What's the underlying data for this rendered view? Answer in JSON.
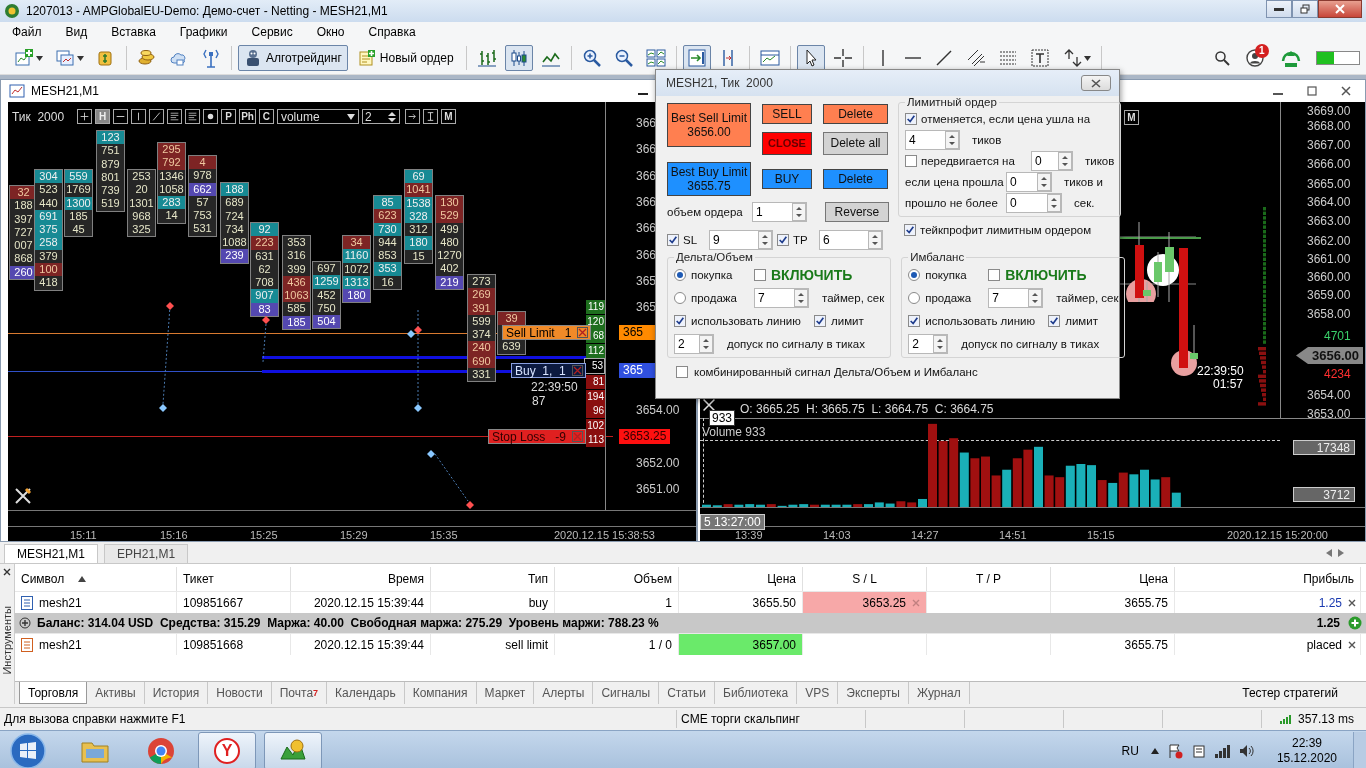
{
  "window": {
    "title": "1207013 - AMPGlobalEU-Demo: Демо-счет - Netting - MESH21,M1"
  },
  "menu": [
    "Файл",
    "Вид",
    "Вставка",
    "Графики",
    "Сервис",
    "Окно",
    "Справка"
  ],
  "toolbar": {
    "tools_left": [
      [
        {
          "kind": "new-chart",
          "selected": false
        },
        {
          "kind": "profiles",
          "selected": false
        },
        {
          "kind": "bag",
          "selected": false
        }
      ],
      [
        {
          "kind": "coins",
          "selected": false
        },
        {
          "kind": "cloud",
          "selected": false
        },
        {
          "kind": "signal",
          "selected": false
        }
      ]
    ],
    "algo_button": {
      "label": "Алготрейдинг",
      "selected": true
    },
    "new_order_button": {
      "label": "Новый ордер"
    },
    "tools_right": [
      [
        {
          "kind": "bars",
          "selected": false
        },
        {
          "kind": "candles",
          "selected": true
        },
        {
          "kind": "line",
          "selected": false
        }
      ],
      [
        {
          "kind": "zoom-in",
          "selected": false
        },
        {
          "kind": "zoom-out",
          "selected": false
        },
        {
          "kind": "tile",
          "selected": false
        }
      ],
      [
        {
          "kind": "autoscroll",
          "selected": true
        },
        {
          "kind": "shift",
          "selected": false
        }
      ],
      [
        {
          "kind": "template",
          "selected": false
        }
      ],
      [
        {
          "kind": "cursor",
          "selected": true
        },
        {
          "kind": "crosshair",
          "selected": false
        }
      ],
      [
        {
          "kind": "vline",
          "selected": false
        },
        {
          "kind": "hline",
          "selected": false
        },
        {
          "kind": "trend",
          "selected": false
        },
        {
          "kind": "channel",
          "selected": false
        },
        {
          "kind": "fibo",
          "selected": false
        },
        {
          "kind": "text",
          "selected": false
        },
        {
          "kind": "arrows",
          "selected": false
        }
      ]
    ],
    "notifications": "1"
  },
  "left_chart": {
    "title": "MESH21,M1",
    "period": "Тик  2000",
    "tools": [
      {
        "kind": "plus",
        "selected": false
      },
      {
        "kind": "letter",
        "label": "H",
        "selected": true
      },
      {
        "kind": "hline",
        "selected": false
      },
      {
        "kind": "vline",
        "selected": false
      },
      {
        "kind": "slash",
        "selected": false
      },
      {
        "kind": "lines",
        "selected": false
      },
      {
        "kind": "lines",
        "selected": false
      },
      {
        "kind": "dot",
        "selected": false
      },
      {
        "kind": "letter",
        "label": "P",
        "selected": false
      },
      {
        "kind": "letter",
        "label": "Ph",
        "selected": false
      },
      {
        "kind": "letter",
        "label": "C",
        "selected": false
      }
    ],
    "indicator_select": "volume",
    "step_value": "2",
    "tools_after": [
      {
        "kind": "arrow",
        "selected": false
      },
      {
        "kind": "ibeam",
        "selected": false
      },
      {
        "kind": "letter",
        "label": "M",
        "selected": false
      }
    ],
    "footprint": [
      {
        "cells": [
          {
            "value": "32",
            "kind": "sell"
          },
          {
            "value": "188",
            "kind": "plain"
          },
          {
            "value": "397",
            "kind": "plain"
          },
          {
            "value": "727",
            "kind": "plain"
          },
          {
            "value": "007",
            "kind": "plain"
          },
          {
            "value": "868",
            "kind": "plain"
          },
          {
            "value": "260",
            "kind": "max"
          }
        ]
      },
      {
        "cells": [
          {
            "value": "304",
            "kind": "buy"
          },
          {
            "value": "523",
            "kind": "plain"
          },
          {
            "value": "440",
            "kind": "plain"
          },
          {
            "value": "691",
            "kind": "buy"
          },
          {
            "value": "375",
            "kind": "buy"
          },
          {
            "value": "258",
            "kind": "buy"
          },
          {
            "value": "379",
            "kind": "plain"
          },
          {
            "value": "100",
            "kind": "sell"
          },
          {
            "value": "418",
            "kind": "plain"
          }
        ]
      },
      {
        "cells": [
          {
            "value": "559",
            "kind": "buy"
          },
          {
            "value": "1769",
            "kind": "plain"
          },
          {
            "value": "1300",
            "kind": "buy"
          },
          {
            "value": "185",
            "kind": "plain"
          },
          {
            "value": "45",
            "kind": "plain"
          }
        ]
      },
      {
        "cells": [
          {
            "value": "123",
            "kind": "buy"
          },
          {
            "value": "751",
            "kind": "plain"
          },
          {
            "value": "879",
            "kind": "plain"
          },
          {
            "value": "801",
            "kind": "plain"
          },
          {
            "value": "739",
            "kind": "plain"
          },
          {
            "value": "519",
            "kind": "plain"
          }
        ]
      },
      {
        "cells": [
          {
            "value": "253",
            "kind": "plain"
          },
          {
            "value": "20",
            "kind": "plain"
          },
          {
            "value": "1301",
            "kind": "plain"
          },
          {
            "value": "968",
            "kind": "plain"
          },
          {
            "value": "325",
            "kind": "plain"
          }
        ]
      },
      {
        "cells": [
          {
            "value": "295",
            "kind": "sell"
          },
          {
            "value": "792",
            "kind": "sell"
          },
          {
            "value": "1346",
            "kind": "plain"
          },
          {
            "value": "1058",
            "kind": "plain"
          },
          {
            "value": "283",
            "kind": "buy"
          },
          {
            "value": "14",
            "kind": "plain"
          }
        ]
      },
      {
        "cells": [
          {
            "value": "4",
            "kind": "sell"
          },
          {
            "value": "978",
            "kind": "plain"
          },
          {
            "value": "662",
            "kind": "max"
          },
          {
            "value": "57",
            "kind": "plain"
          },
          {
            "value": "753",
            "kind": "plain"
          },
          {
            "value": "531",
            "kind": "plain"
          }
        ]
      },
      {
        "cells": [
          {
            "value": "188",
            "kind": "buy"
          },
          {
            "value": "689",
            "kind": "plain"
          },
          {
            "value": "724",
            "kind": "plain"
          },
          {
            "value": "734",
            "kind": "plain"
          },
          {
            "value": "1088",
            "kind": "plain"
          },
          {
            "value": "239",
            "kind": "max"
          }
        ]
      },
      {
        "cells": [
          {
            "value": "92",
            "kind": "buy"
          },
          {
            "value": "223",
            "kind": "sell"
          },
          {
            "value": "631",
            "kind": "plain"
          },
          {
            "value": "62",
            "kind": "plain"
          },
          {
            "value": "708",
            "kind": "plain"
          },
          {
            "value": "907",
            "kind": "buy"
          },
          {
            "value": "83",
            "kind": "max"
          }
        ]
      },
      {
        "cells": [
          {
            "value": "353",
            "kind": "plain"
          },
          {
            "value": "316",
            "kind": "plain"
          },
          {
            "value": "399",
            "kind": "plain"
          },
          {
            "value": "436",
            "kind": "sell"
          },
          {
            "value": "1063",
            "kind": "sell"
          },
          {
            "value": "585",
            "kind": "plain"
          },
          {
            "value": "185",
            "kind": "max"
          }
        ]
      },
      {
        "cells": [
          {
            "value": "697",
            "kind": "plain"
          },
          {
            "value": "1259",
            "kind": "buy"
          },
          {
            "value": "452",
            "kind": "plain"
          },
          {
            "value": "750",
            "kind": "plain"
          },
          {
            "value": "504",
            "kind": "max"
          }
        ]
      },
      {
        "cells": [
          {
            "value": "34",
            "kind": "sell"
          },
          {
            "value": "1160",
            "kind": "buy"
          },
          {
            "value": "1072",
            "kind": "plain"
          },
          {
            "value": "1313",
            "kind": "buy"
          },
          {
            "value": "180",
            "kind": "max"
          }
        ]
      },
      {
        "cells": [
          {
            "value": "85",
            "kind": "buy"
          },
          {
            "value": "623",
            "kind": "sell"
          },
          {
            "value": "730",
            "kind": "buy"
          },
          {
            "value": "944",
            "kind": "plain"
          },
          {
            "value": "853",
            "kind": "plain"
          },
          {
            "value": "353",
            "kind": "buy"
          },
          {
            "value": "16",
            "kind": "plain"
          }
        ]
      },
      {
        "cells": [
          {
            "value": "69",
            "kind": "buy"
          },
          {
            "value": "1041",
            "kind": "sell"
          },
          {
            "value": "1538",
            "kind": "buy"
          },
          {
            "value": "328",
            "kind": "buy"
          },
          {
            "value": "312",
            "kind": "plain"
          },
          {
            "value": "180",
            "kind": "buy"
          },
          {
            "value": "15",
            "kind": "plain"
          }
        ]
      },
      {
        "cells": [
          {
            "value": "130",
            "kind": "sell"
          },
          {
            "value": "529",
            "kind": "sell"
          },
          {
            "value": "499",
            "kind": "plain"
          },
          {
            "value": "480",
            "kind": "plain"
          },
          {
            "value": "1270",
            "kind": "plain"
          },
          {
            "value": "402",
            "kind": "plain"
          },
          {
            "value": "219",
            "kind": "max"
          }
        ]
      },
      {
        "cells": [
          {
            "value": "273",
            "kind": "plain"
          },
          {
            "value": "269",
            "kind": "sell"
          },
          {
            "value": "391",
            "kind": "sell"
          },
          {
            "value": "599",
            "kind": "plain"
          },
          {
            "value": "374",
            "kind": "plain"
          },
          {
            "value": "240",
            "kind": "sell"
          },
          {
            "value": "690",
            "kind": "sell"
          },
          {
            "value": "331",
            "kind": "plain"
          }
        ]
      },
      {
        "cells": [
          {
            "value": "39",
            "kind": "sell"
          },
          {
            "value": "639",
            "kind": "plain"
          }
        ]
      }
    ],
    "side_volumes": [
      {
        "value": "119",
        "kind": "ask"
      },
      {
        "value": "120",
        "kind": "ask"
      },
      {
        "value": "68",
        "kind": "ask"
      },
      {
        "value": "112",
        "kind": "ask"
      },
      {
        "value": "53",
        "kind": "neutral"
      },
      {
        "value": "81",
        "kind": "bid"
      },
      {
        "value": "194",
        "kind": "bid"
      },
      {
        "value": "96",
        "kind": "bid"
      },
      {
        "value": "102",
        "kind": "bid"
      },
      {
        "value": "113",
        "kind": "bid"
      }
    ],
    "orders": [
      {
        "label": "Sell Limit   1",
        "kind": "sell_limit",
        "price": "365"
      },
      {
        "label": "Buy  1,  1",
        "kind": "buy",
        "price": "365"
      },
      {
        "label": "Stop Loss   -9",
        "kind": "stop_loss",
        "price": "3653.25"
      }
    ],
    "last_time": "22:39:50",
    "tick_count": "87",
    "price_axis": [
      "366",
      "366",
      "366",
      "366",
      "366",
      "366",
      "365",
      "365",
      "3654.00",
      "3652.00",
      "3651.00"
    ],
    "time_axis": [
      "15:11",
      "15:16",
      "15:25",
      "15:29",
      "15:35"
    ],
    "time_end": "2020.12.15 15:38:53"
  },
  "right_chart": {
    "tool_label": "M",
    "price_axis": [
      "3669.00",
      "3668.00",
      "3667.00",
      "3666.00",
      "3665.00",
      "3664.00",
      "3663.00",
      "3662.00",
      "3661.00",
      "3660.00",
      "3659.00",
      "3658.00",
      "3654.00",
      "3653.00"
    ],
    "ask_volume": "4701",
    "current_price": "3656.00",
    "bid_volume": "4234",
    "time": "22:39:50",
    "countdown": "01:57",
    "ohlc": "O: 3665.25  H: 3665.75  L: 3664.75  C: 3664.75",
    "tooltip": "933",
    "volume_label": "Volume 933",
    "volume_high": "17348",
    "volume_low": "3712",
    "time_box": "5 13:27:00",
    "time_axis": [
      "13:39",
      "14:03",
      "14:27",
      "14:51",
      "15:15"
    ],
    "time_end": "2020.12.15 15:20:00"
  },
  "dialog": {
    "title": "MESH21, Тик  2000",
    "best_sell": {
      "label": "Best Sell Limit",
      "price": "3656.00"
    },
    "best_buy": {
      "label": "Best Buy Limit",
      "price": "3655.75"
    },
    "buttons": [
      {
        "label": "SELL",
        "kind": "sell"
      },
      {
        "label": "Delete",
        "kind": "sell"
      },
      {
        "label": "CLOSE",
        "kind": "close"
      },
      {
        "label": "Delete all",
        "kind": "neutral"
      },
      {
        "label": "BUY",
        "kind": "buy"
      },
      {
        "label": "Delete",
        "kind": "buy"
      }
    ],
    "volume": {
      "label": "объем ордера",
      "value": "1"
    },
    "reverse": "Reverse",
    "sl": {
      "label": "SL",
      "checked": true,
      "value": "9"
    },
    "tp": {
      "label": "TP",
      "checked": true,
      "value": "6"
    },
    "limit_order": {
      "title": "Лимитный ордер",
      "cancel": {
        "label": "отменяется, если цена ушла на",
        "checked": true
      },
      "cancel_ticks": "4",
      "cancel_unit": "тиков",
      "move": {
        "label": "передвигается на",
        "checked": false
      },
      "move_value": "0",
      "move_unit": "тиков",
      "passed_label": "если цена прошла",
      "passed_value": "0",
      "passed_unit": "тиков и",
      "time_label": "прошло не более",
      "time_value": "0",
      "time_unit": "сек."
    },
    "take_profit_limit": {
      "label": "тейкпрофит лимитным ордером",
      "checked": true
    },
    "signal_groups": [
      {
        "title": "Дельта/Объем",
        "options": [
          {
            "label": "покупка",
            "selected": true
          },
          {
            "label": "продажа",
            "selected": false
          }
        ],
        "enable": {
          "label": "ВКЛЮЧИТЬ",
          "checked": false
        },
        "timer_value": "7",
        "timer_label": "таймер, сек",
        "use_line": {
          "label": "использовать линию",
          "checked": true
        },
        "limit": {
          "label": "лимит",
          "checked": true
        },
        "tolerance_value": "2",
        "tolerance_label": "допуск по сигналу в тиках"
      },
      {
        "title": "Имбаланс",
        "options": [
          {
            "label": "покупка",
            "selected": true
          },
          {
            "label": "продажа",
            "selected": false
          }
        ],
        "enable": {
          "label": "ВКЛЮЧИТЬ",
          "checked": false
        },
        "timer_value": "7",
        "timer_label": "таймер, сек",
        "use_line": {
          "label": "использовать линию",
          "checked": true
        },
        "limit": {
          "label": "лимит",
          "checked": true
        },
        "tolerance_value": "2",
        "tolerance_label": "допуск по сигналу в тиках"
      }
    ],
    "combined": {
      "label": "комбинированный сигнал Дельта/Объем и Имбаланс",
      "checked": false
    }
  },
  "chart_tabs": [
    {
      "label": "MESH21,M1",
      "selected": true
    },
    {
      "label": "EPH21,M1",
      "selected": false
    }
  ],
  "toolbox": {
    "side_label": "Инструменты",
    "columns": [
      {
        "label": "Символ",
        "sorted": true
      },
      {
        "label": "Тикет",
        "sorted": false
      },
      {
        "label": "Время",
        "sorted": false
      },
      {
        "label": "Тип",
        "sorted": false
      },
      {
        "label": "Объем",
        "sorted": false
      },
      {
        "label": "Цена",
        "sorted": false
      },
      {
        "label": "S / L",
        "sorted": false
      },
      {
        "label": "T / P",
        "sorted": false
      },
      {
        "label": "Цена",
        "sorted": false
      },
      {
        "label": "Прибыль",
        "sorted": false
      }
    ],
    "rows": [
      {
        "kind": "position",
        "symbol": "mesh21",
        "ticket": "109851667",
        "time": "2020.12.15 15:39:44",
        "type": "buy",
        "volume": "1",
        "price": "3655.50",
        "sl": "3653.25",
        "current": "3655.75",
        "profit": "1.25"
      },
      {
        "kind": "summary",
        "text": "Баланс: 314.04 USD  Средства: 315.29  Маржа: 40.00  Свободная маржа: 275.29  Уровень маржи: 788.23 %",
        "profit": "1.25"
      },
      {
        "kind": "order",
        "symbol": "mesh21",
        "ticket": "109851668",
        "time": "2020.12.15 15:39:44",
        "type": "sell limit",
        "volume": "1 / 0",
        "price": "3657.00",
        "current": "3655.75",
        "profit": "placed"
      }
    ],
    "tabs": [
      {
        "label": "Торговля",
        "selected": true
      },
      {
        "label": "Активы",
        "selected": false
      },
      {
        "label": "История",
        "selected": false
      },
      {
        "label": "Новости",
        "selected": false
      },
      {
        "label": "Почта",
        "badge": "7",
        "selected": false
      },
      {
        "label": "Календарь",
        "selected": false
      },
      {
        "label": "Компания",
        "selected": false
      },
      {
        "label": "Маркет",
        "selected": false
      },
      {
        "label": "Алерты",
        "selected": false
      },
      {
        "label": "Сигналы",
        "selected": false
      },
      {
        "label": "Статьи",
        "selected": false
      },
      {
        "label": "Библиотека",
        "selected": false
      },
      {
        "label": "VPS",
        "selected": false
      },
      {
        "label": "Эксперты",
        "selected": false
      },
      {
        "label": "Журнал",
        "selected": false
      }
    ],
    "tester": "Тестер стратегий"
  },
  "status_bar": {
    "help": "Для вызова справки нажмите F1",
    "profile": "CME торги скальпинг",
    "ping": "357.13 ms"
  },
  "taskbar": {
    "apps": [
      {
        "kind": "folder",
        "selected": false
      },
      {
        "kind": "browser",
        "selected": false
      },
      {
        "kind": "letter",
        "label": "Y",
        "selected": true
      },
      {
        "kind": "trading",
        "selected": true
      }
    ],
    "language": "RU",
    "time": "22:39",
    "date": "15.12.2020"
  }
}
